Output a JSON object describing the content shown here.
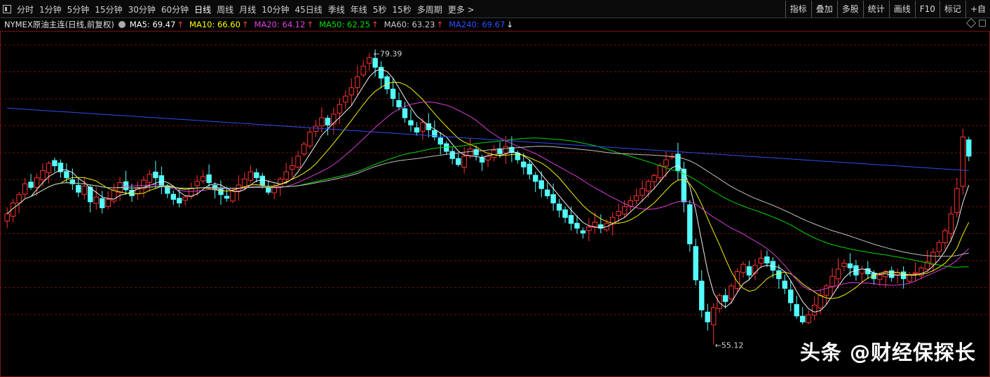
{
  "toolbar": {
    "periods": [
      "分时",
      "1分钟",
      "5分钟",
      "15分钟",
      "30分钟",
      "60分钟",
      "日线",
      "周线",
      "月线",
      "10分钟",
      "45日线",
      "季线",
      "年线",
      "5秒",
      "15秒",
      "多周期",
      "更多 >"
    ],
    "active_period": "日线",
    "right_buttons": [
      "指标",
      "叠加",
      "多股",
      "统计",
      "画线",
      "F10",
      "标记",
      "+自"
    ]
  },
  "infobar": {
    "instrument": "NYMEX原油主连(日线,前复权)",
    "ma": [
      {
        "label": "MA5: 69.47",
        "color": "#ffffff",
        "arrow": "↑",
        "arrow_color": "#ff4040"
      },
      {
        "label": "MA10: 66.60",
        "color": "#ffff00",
        "arrow": "↑",
        "arrow_color": "#ff4040"
      },
      {
        "label": "MA20: 64.12",
        "color": "#e040e0",
        "arrow": "↑",
        "arrow_color": "#ff4040"
      },
      {
        "label": "MA50: 62.25",
        "color": "#00e000",
        "arrow": "↑",
        "arrow_color": "#ff4040"
      },
      {
        "label": "MA60: 63.23",
        "color": "#c8c8c8",
        "arrow": "↑",
        "arrow_color": "#ff4040"
      },
      {
        "label": "MA240: 69.67",
        "color": "#3050ff",
        "arrow": "↓",
        "arrow_color": "#ffffff"
      }
    ]
  },
  "chart_data": {
    "type": "candlestick",
    "high_label": "79.39",
    "low_label": "55.12",
    "ylim": [
      53.0,
      81.0
    ],
    "grid": "horizontal dashed",
    "up_color": "#ff3232",
    "down_color": "#54ffff",
    "closes": [
      66.0,
      66.9,
      67.6,
      68.5,
      68.2,
      69.0,
      69.6,
      70.2,
      70.0,
      69.5,
      69.0,
      68.5,
      67.8,
      68.3,
      67.0,
      67.4,
      66.5,
      67.2,
      68.0,
      68.6,
      68.0,
      67.5,
      68.2,
      68.8,
      69.3,
      69.0,
      68.3,
      67.7,
      67.2,
      66.9,
      67.4,
      68.1,
      68.7,
      69.1,
      68.6,
      68.0,
      67.6,
      67.3,
      67.9,
      68.4,
      68.9,
      69.5,
      69.0,
      68.4,
      67.8,
      68.3,
      68.9,
      69.5,
      70.0,
      70.8,
      71.8,
      72.8,
      73.3,
      74.0,
      73.4,
      74.3,
      75.1,
      75.8,
      76.5,
      77.4,
      78.3,
      79.0,
      78.2,
      77.3,
      76.4,
      75.6,
      74.9,
      74.0,
      73.4,
      72.8,
      73.6,
      73.0,
      72.4,
      71.8,
      71.2,
      70.6,
      70.1,
      70.8,
      71.4,
      70.9,
      70.3,
      70.8,
      71.3,
      71.0,
      71.6,
      71.1,
      70.5,
      69.9,
      69.3,
      68.7,
      68.1,
      67.5,
      66.9,
      66.3,
      65.7,
      65.2,
      64.8,
      64.4,
      64.9,
      65.3,
      64.8,
      65.2,
      65.7,
      66.2,
      66.6,
      67.1,
      67.5,
      68.1,
      68.7,
      69.2,
      70.0,
      70.5,
      70.8,
      69.6,
      67.0,
      63.5,
      60.5,
      58.0,
      57.0,
      58.2,
      59.2,
      58.7,
      60.0,
      61.2,
      61.8,
      60.9,
      61.7,
      62.3,
      61.9,
      61.3,
      60.6,
      59.8,
      58.6,
      57.5,
      57.0,
      57.6,
      58.4,
      59.2,
      60.0,
      60.8,
      61.4,
      61.9,
      61.5,
      60.9,
      61.4,
      61.0,
      60.6,
      60.9,
      61.2,
      60.7,
      61.1,
      60.6,
      60.9,
      61.1,
      61.5,
      62.0,
      62.8,
      63.6,
      64.6,
      66.0,
      68.1,
      72.4,
      70.8
    ]
  },
  "watermark": "头条 @财经保探长"
}
